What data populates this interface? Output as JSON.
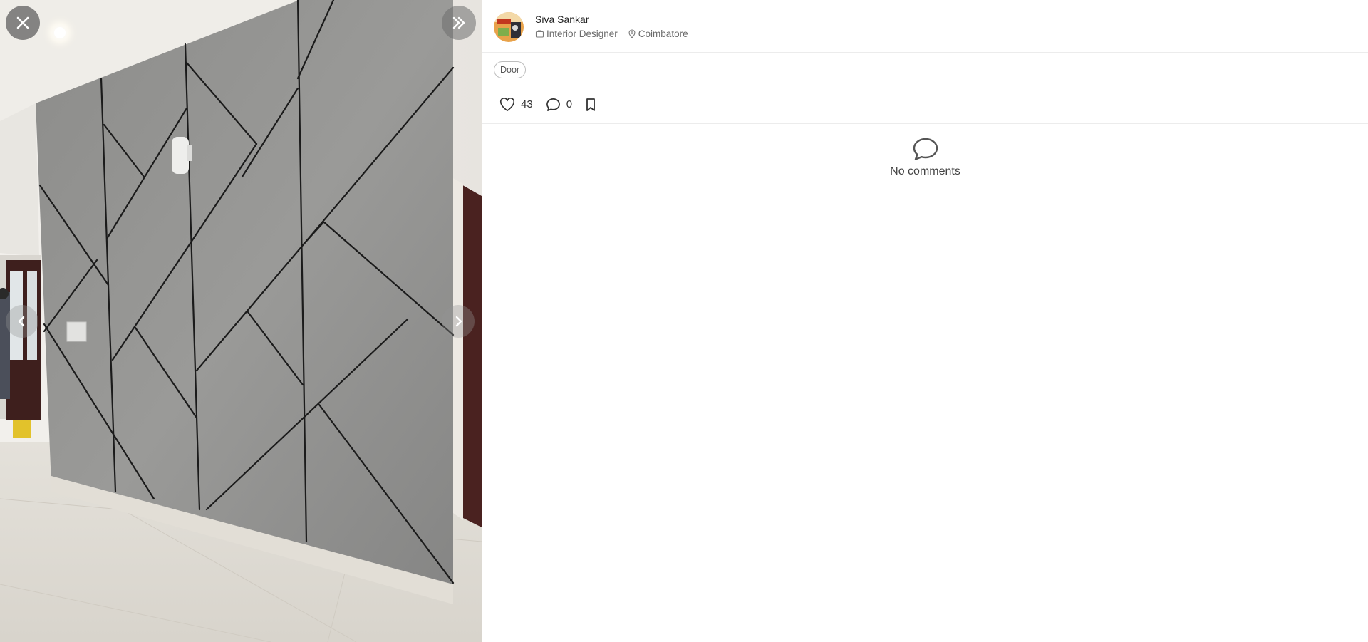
{
  "viewer": {
    "close_icon": "close-icon",
    "expand_icon": "chevrons-right-icon",
    "prev_icon": "chevron-left-icon",
    "next_icon": "chevron-right-icon"
  },
  "post": {
    "author": {
      "name": "Siva Sankar",
      "profession": "Interior Designer",
      "location": "Coimbatore"
    },
    "tag": "Door",
    "likes": "43",
    "comments_count": "0",
    "empty_comments_text": "No comments"
  },
  "colors": {
    "wall": "#8e8e8c",
    "floor": "#dedad3",
    "door": "#4a2220"
  }
}
